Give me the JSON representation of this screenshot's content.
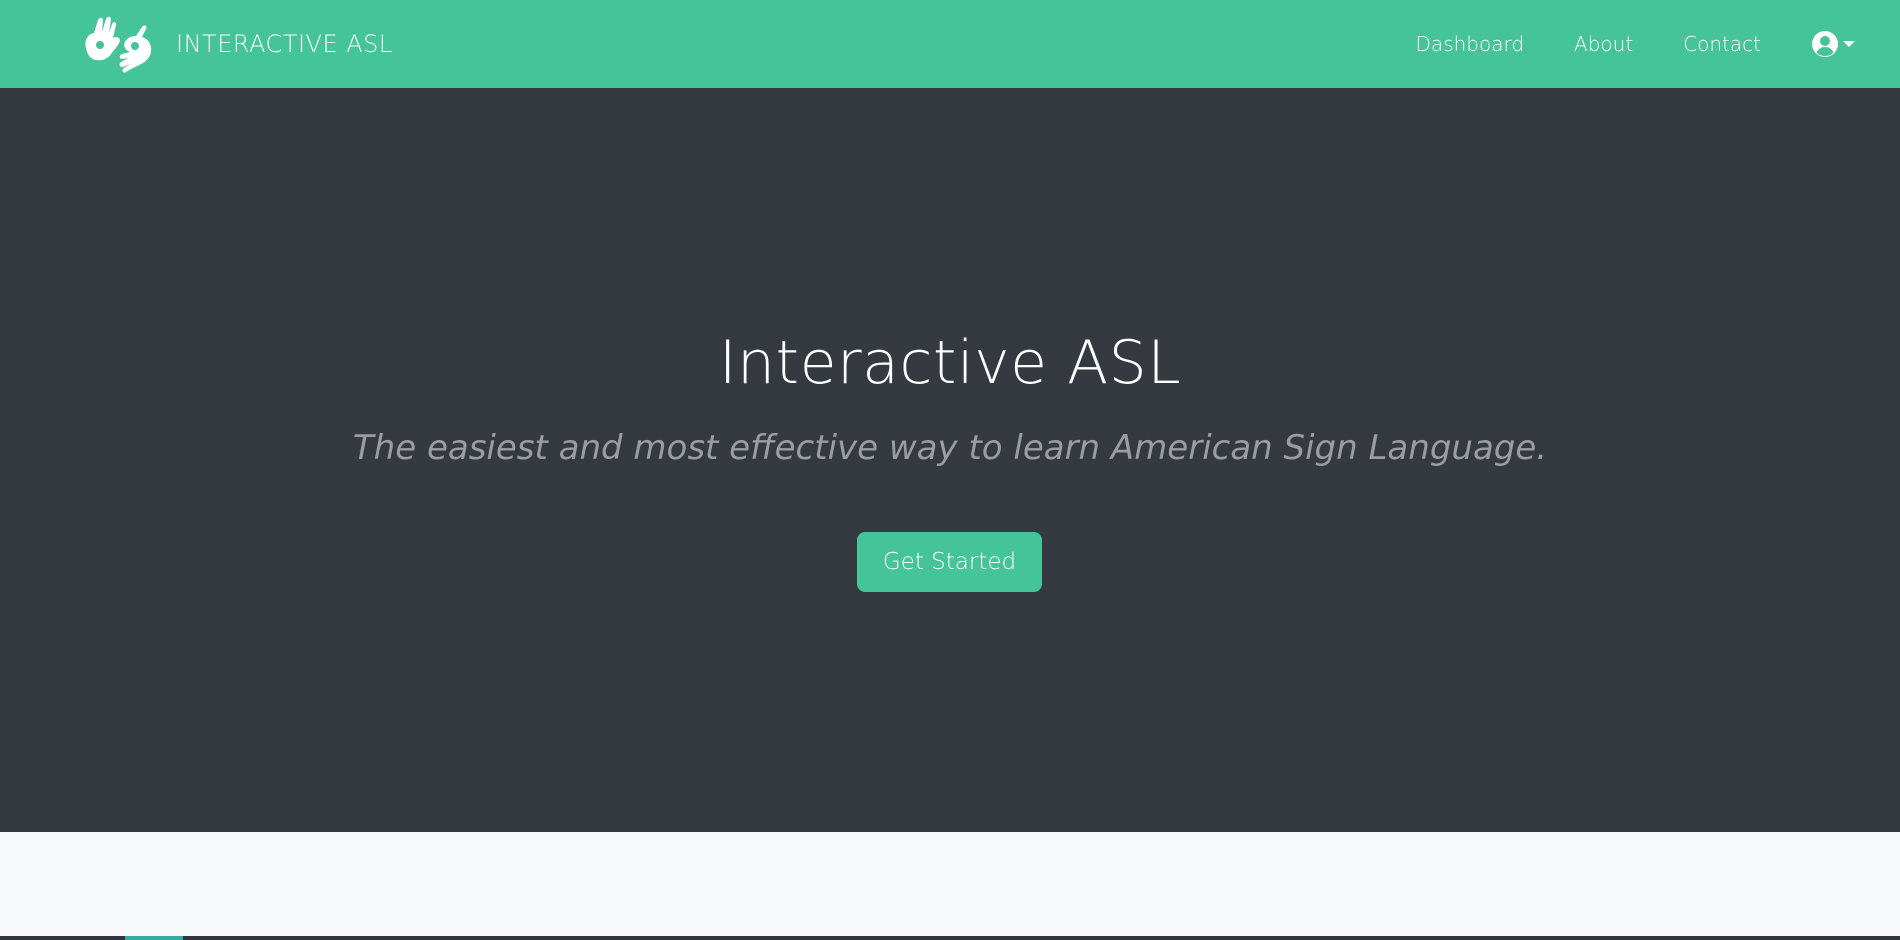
{
  "navbar": {
    "brand": {
      "logo_icon": "asl-hands-icon",
      "name": "INTERACTIVE ASL"
    },
    "links": [
      {
        "label": "Dashboard"
      },
      {
        "label": "About"
      },
      {
        "label": "Contact"
      }
    ],
    "user_menu": {
      "icon": "user-circle-icon",
      "caret": "caret-down-icon"
    }
  },
  "hero": {
    "title": "Interactive ASL",
    "subtitle": "The easiest and most effective way to learn American Sign Language.",
    "cta_label": "Get Started"
  },
  "colors": {
    "accent": "#45c49a",
    "hero_background": "#343a40",
    "subtitle_text": "#9a9ea3",
    "page_background": "#f8f9fa"
  }
}
